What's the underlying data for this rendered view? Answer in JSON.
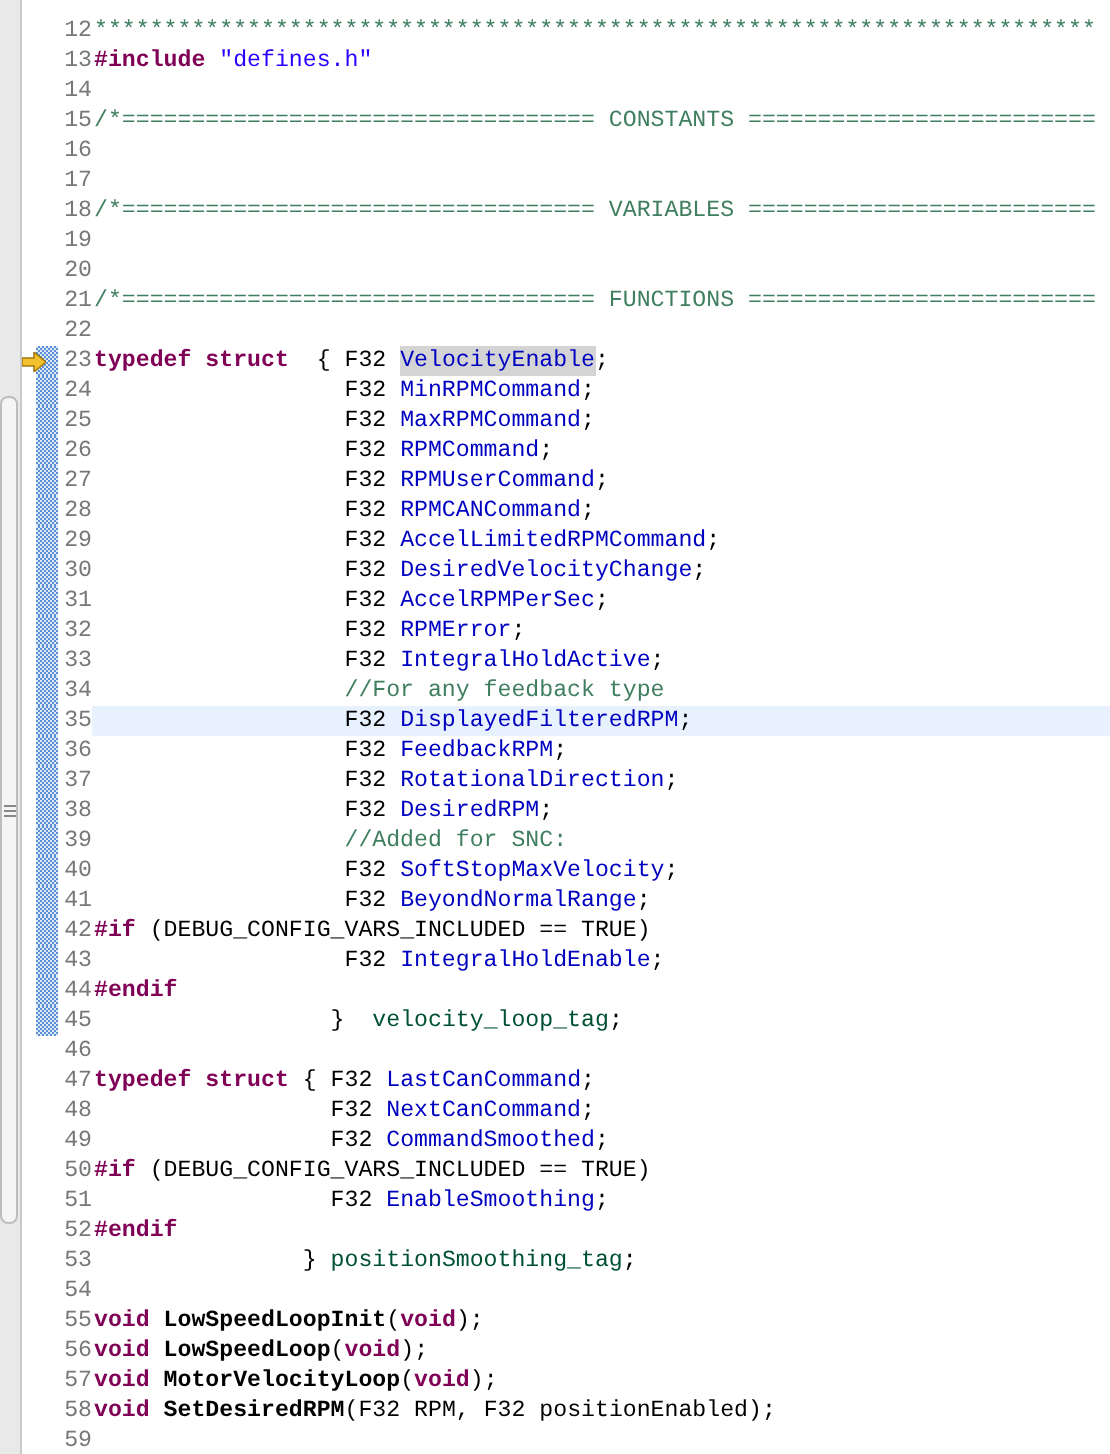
{
  "editor": {
    "lines": [
      {
        "number": "12",
        "current": false,
        "changed": false,
        "pointer": false,
        "tokens": [
          {
            "kind": "comment",
            "text": "************************************************************************"
          }
        ]
      },
      {
        "number": "13",
        "current": false,
        "changed": false,
        "pointer": false,
        "tokens": [
          {
            "kind": "preproc",
            "text": "#include "
          },
          {
            "kind": "string",
            "text": "\"defines.h\""
          }
        ]
      },
      {
        "number": "14",
        "current": false,
        "changed": false,
        "pointer": false
      },
      {
        "number": "15",
        "current": false,
        "changed": false,
        "pointer": false,
        "tokens": [
          {
            "kind": "comment",
            "text": "/*================================== CONSTANTS ========================="
          }
        ]
      },
      {
        "number": "16",
        "current": false,
        "changed": false,
        "pointer": false
      },
      {
        "number": "17",
        "current": false,
        "changed": false,
        "pointer": false
      },
      {
        "number": "18",
        "current": false,
        "changed": false,
        "pointer": false,
        "tokens": [
          {
            "kind": "comment",
            "text": "/*================================== VARIABLES ========================="
          }
        ]
      },
      {
        "number": "19",
        "current": false,
        "changed": false,
        "pointer": false
      },
      {
        "number": "20",
        "current": false,
        "changed": false,
        "pointer": false
      },
      {
        "number": "21",
        "current": false,
        "changed": false,
        "pointer": false,
        "tokens": [
          {
            "kind": "comment",
            "text": "/*================================== FUNCTIONS ========================="
          }
        ]
      },
      {
        "number": "22",
        "current": false,
        "changed": false,
        "pointer": false
      },
      {
        "number": "23",
        "current": false,
        "changed": true,
        "pointer": true,
        "tokens": [
          {
            "kind": "keyword",
            "text": "typedef "
          },
          {
            "kind": "keyword",
            "text": "struct"
          },
          {
            "kind": "plain",
            "text": "  { F32 "
          },
          {
            "kind": "occurrence",
            "text": "VelocityEnable"
          },
          {
            "kind": "plain",
            "text": ";"
          }
        ]
      },
      {
        "number": "24",
        "current": false,
        "changed": true,
        "pointer": false,
        "tokens": [
          {
            "kind": "plain",
            "text": "                  F32 "
          },
          {
            "kind": "field",
            "text": "MinRPMCommand"
          },
          {
            "kind": "plain",
            "text": ";"
          }
        ]
      },
      {
        "number": "25",
        "current": false,
        "changed": true,
        "pointer": false,
        "tokens": [
          {
            "kind": "plain",
            "text": "                  F32 "
          },
          {
            "kind": "field",
            "text": "MaxRPMCommand"
          },
          {
            "kind": "plain",
            "text": ";"
          }
        ]
      },
      {
        "number": "26",
        "current": false,
        "changed": true,
        "pointer": false,
        "tokens": [
          {
            "kind": "plain",
            "text": "                  F32 "
          },
          {
            "kind": "field",
            "text": "RPMCommand"
          },
          {
            "kind": "plain",
            "text": ";"
          }
        ]
      },
      {
        "number": "27",
        "current": false,
        "changed": true,
        "pointer": false,
        "tokens": [
          {
            "kind": "plain",
            "text": "                  F32 "
          },
          {
            "kind": "field",
            "text": "RPMUserCommand"
          },
          {
            "kind": "plain",
            "text": ";"
          }
        ]
      },
      {
        "number": "28",
        "current": false,
        "changed": true,
        "pointer": false,
        "tokens": [
          {
            "kind": "plain",
            "text": "                  F32 "
          },
          {
            "kind": "field",
            "text": "RPMCANCommand"
          },
          {
            "kind": "plain",
            "text": ";"
          }
        ]
      },
      {
        "number": "29",
        "current": false,
        "changed": true,
        "pointer": false,
        "tokens": [
          {
            "kind": "plain",
            "text": "                  F32 "
          },
          {
            "kind": "field",
            "text": "AccelLimitedRPMCommand"
          },
          {
            "kind": "plain",
            "text": ";"
          }
        ]
      },
      {
        "number": "30",
        "current": false,
        "changed": true,
        "pointer": false,
        "tokens": [
          {
            "kind": "plain",
            "text": "                  F32 "
          },
          {
            "kind": "field",
            "text": "DesiredVelocityChange"
          },
          {
            "kind": "plain",
            "text": ";"
          }
        ]
      },
      {
        "number": "31",
        "current": false,
        "changed": true,
        "pointer": false,
        "tokens": [
          {
            "kind": "plain",
            "text": "                  F32 "
          },
          {
            "kind": "field",
            "text": "AccelRPMPerSec"
          },
          {
            "kind": "plain",
            "text": ";"
          }
        ]
      },
      {
        "number": "32",
        "current": false,
        "changed": true,
        "pointer": false,
        "tokens": [
          {
            "kind": "plain",
            "text": "                  F32 "
          },
          {
            "kind": "field",
            "text": "RPMError"
          },
          {
            "kind": "plain",
            "text": ";"
          }
        ]
      },
      {
        "number": "33",
        "current": false,
        "changed": true,
        "pointer": false,
        "tokens": [
          {
            "kind": "plain",
            "text": "                  F32 "
          },
          {
            "kind": "field",
            "text": "IntegralHoldActive"
          },
          {
            "kind": "plain",
            "text": ";"
          }
        ]
      },
      {
        "number": "34",
        "current": false,
        "changed": true,
        "pointer": false,
        "tokens": [
          {
            "kind": "comment",
            "text": "                  //For any feedback type"
          }
        ]
      },
      {
        "number": "35",
        "current": true,
        "changed": true,
        "pointer": false,
        "tokens": [
          {
            "kind": "plain",
            "text": "                  F32 "
          },
          {
            "kind": "field",
            "text": "DisplayedFilteredRPM"
          },
          {
            "kind": "plain",
            "text": ";"
          }
        ]
      },
      {
        "number": "36",
        "current": false,
        "changed": true,
        "pointer": false,
        "tokens": [
          {
            "kind": "plain",
            "text": "                  F32 "
          },
          {
            "kind": "field",
            "text": "FeedbackRPM"
          },
          {
            "kind": "plain",
            "text": ";"
          }
        ]
      },
      {
        "number": "37",
        "current": false,
        "changed": true,
        "pointer": false,
        "tokens": [
          {
            "kind": "plain",
            "text": "                  F32 "
          },
          {
            "kind": "field",
            "text": "RotationalDirection"
          },
          {
            "kind": "plain",
            "text": ";"
          }
        ]
      },
      {
        "number": "38",
        "current": false,
        "changed": true,
        "pointer": false,
        "tokens": [
          {
            "kind": "plain",
            "text": "                  F32 "
          },
          {
            "kind": "field",
            "text": "DesiredRPM"
          },
          {
            "kind": "plain",
            "text": ";"
          }
        ]
      },
      {
        "number": "39",
        "current": false,
        "changed": true,
        "pointer": false,
        "tokens": [
          {
            "kind": "comment",
            "text": "                  //Added for SNC:"
          }
        ]
      },
      {
        "number": "40",
        "current": false,
        "changed": true,
        "pointer": false,
        "tokens": [
          {
            "kind": "plain",
            "text": "                  F32 "
          },
          {
            "kind": "field",
            "text": "SoftStopMaxVelocity"
          },
          {
            "kind": "plain",
            "text": ";"
          }
        ]
      },
      {
        "number": "41",
        "current": false,
        "changed": true,
        "pointer": false,
        "tokens": [
          {
            "kind": "plain",
            "text": "                  F32 "
          },
          {
            "kind": "field",
            "text": "BeyondNormalRange"
          },
          {
            "kind": "plain",
            "text": ";"
          }
        ]
      },
      {
        "number": "42",
        "current": false,
        "changed": true,
        "pointer": false,
        "tokens": [
          {
            "kind": "preproc",
            "text": "#if"
          },
          {
            "kind": "plain",
            "text": " (DEBUG_CONFIG_VARS_INCLUDED == TRUE)"
          }
        ]
      },
      {
        "number": "43",
        "current": false,
        "changed": true,
        "pointer": false,
        "tokens": [
          {
            "kind": "plain",
            "text": "                  F32 "
          },
          {
            "kind": "field",
            "text": "IntegralHoldEnable"
          },
          {
            "kind": "plain",
            "text": ";"
          }
        ]
      },
      {
        "number": "44",
        "current": false,
        "changed": true,
        "pointer": false,
        "tokens": [
          {
            "kind": "preproc",
            "text": "#endif"
          }
        ]
      },
      {
        "number": "45",
        "current": false,
        "changed": true,
        "pointer": false,
        "tokens": [
          {
            "kind": "plain",
            "text": "                 }  "
          },
          {
            "kind": "typename",
            "text": "velocity_loop_tag"
          },
          {
            "kind": "plain",
            "text": ";"
          }
        ]
      },
      {
        "number": "46",
        "current": false,
        "changed": false,
        "pointer": false
      },
      {
        "number": "47",
        "current": false,
        "changed": false,
        "pointer": false,
        "tokens": [
          {
            "kind": "keyword",
            "text": "typedef "
          },
          {
            "kind": "keyword",
            "text": "struct"
          },
          {
            "kind": "plain",
            "text": " { F32 "
          },
          {
            "kind": "field",
            "text": "LastCanCommand"
          },
          {
            "kind": "plain",
            "text": ";"
          }
        ]
      },
      {
        "number": "48",
        "current": false,
        "changed": false,
        "pointer": false,
        "tokens": [
          {
            "kind": "plain",
            "text": "                 F32 "
          },
          {
            "kind": "field",
            "text": "NextCanCommand"
          },
          {
            "kind": "plain",
            "text": ";"
          }
        ]
      },
      {
        "number": "49",
        "current": false,
        "changed": false,
        "pointer": false,
        "tokens": [
          {
            "kind": "plain",
            "text": "                 F32 "
          },
          {
            "kind": "field",
            "text": "CommandSmoothed"
          },
          {
            "kind": "plain",
            "text": ";"
          }
        ]
      },
      {
        "number": "50",
        "current": false,
        "changed": false,
        "pointer": false,
        "tokens": [
          {
            "kind": "preproc",
            "text": "#if"
          },
          {
            "kind": "plain",
            "text": " (DEBUG_CONFIG_VARS_INCLUDED == TRUE)"
          }
        ]
      },
      {
        "number": "51",
        "current": false,
        "changed": false,
        "pointer": false,
        "tokens": [
          {
            "kind": "plain",
            "text": "                 F32 "
          },
          {
            "kind": "field",
            "text": "EnableSmoothing"
          },
          {
            "kind": "plain",
            "text": ";"
          }
        ]
      },
      {
        "number": "52",
        "current": false,
        "changed": false,
        "pointer": false,
        "tokens": [
          {
            "kind": "preproc",
            "text": "#endif"
          }
        ]
      },
      {
        "number": "53",
        "current": false,
        "changed": false,
        "pointer": false,
        "tokens": [
          {
            "kind": "plain",
            "text": "               } "
          },
          {
            "kind": "typename",
            "text": "positionSmoothing_tag"
          },
          {
            "kind": "plain",
            "text": ";"
          }
        ]
      },
      {
        "number": "54",
        "current": false,
        "changed": false,
        "pointer": false
      },
      {
        "number": "55",
        "current": false,
        "changed": false,
        "pointer": false,
        "tokens": [
          {
            "kind": "keyword",
            "text": "void "
          },
          {
            "kind": "function",
            "text": "LowSpeedLoopInit"
          },
          {
            "kind": "plain",
            "text": "("
          },
          {
            "kind": "keyword",
            "text": "void"
          },
          {
            "kind": "plain",
            "text": ");"
          }
        ]
      },
      {
        "number": "56",
        "current": false,
        "changed": false,
        "pointer": false,
        "tokens": [
          {
            "kind": "keyword",
            "text": "void "
          },
          {
            "kind": "function",
            "text": "LowSpeedLoop"
          },
          {
            "kind": "plain",
            "text": "("
          },
          {
            "kind": "keyword",
            "text": "void"
          },
          {
            "kind": "plain",
            "text": ");"
          }
        ]
      },
      {
        "number": "57",
        "current": false,
        "changed": false,
        "pointer": false,
        "tokens": [
          {
            "kind": "keyword",
            "text": "void "
          },
          {
            "kind": "function",
            "text": "MotorVelocityLoop"
          },
          {
            "kind": "plain",
            "text": "("
          },
          {
            "kind": "keyword",
            "text": "void"
          },
          {
            "kind": "plain",
            "text": ");"
          }
        ]
      },
      {
        "number": "58",
        "current": false,
        "changed": false,
        "pointer": false,
        "tokens": [
          {
            "kind": "keyword",
            "text": "void "
          },
          {
            "kind": "function",
            "text": "SetDesiredRPM"
          },
          {
            "kind": "plain",
            "text": "(F32 RPM, F32 positionEnabled);"
          }
        ]
      },
      {
        "number": "59",
        "current": false,
        "changed": false,
        "pointer": false
      }
    ]
  }
}
